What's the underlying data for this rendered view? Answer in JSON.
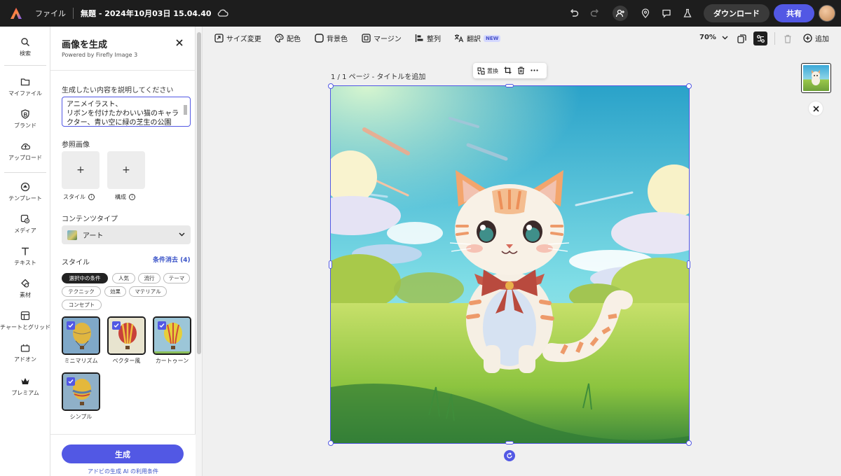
{
  "topbar": {
    "menu_file": "ファイル",
    "doc_title": "無題 - 2024年10月03日 15.04.40",
    "download_label": "ダウンロード",
    "share_label": "共有"
  },
  "rail": {
    "items": [
      {
        "label": "検索",
        "icon": "search-icon"
      },
      {
        "label": "マイファイル",
        "icon": "folder-icon"
      },
      {
        "label": "ブランド",
        "icon": "brand-icon"
      },
      {
        "label": "アップロード",
        "icon": "upload-icon"
      },
      {
        "label": "テンプレート",
        "icon": "template-icon"
      },
      {
        "label": "メディア",
        "icon": "media-icon"
      },
      {
        "label": "テキスト",
        "icon": "text-icon"
      },
      {
        "label": "素材",
        "icon": "shapes-icon"
      },
      {
        "label": "チャートとグリッド",
        "icon": "grid-icon"
      },
      {
        "label": "アドオン",
        "icon": "addon-icon"
      },
      {
        "label": "プレミアム",
        "icon": "crown-icon"
      }
    ]
  },
  "panel": {
    "title": "画像を生成",
    "subtitle": "Powered by Firefly Image 3",
    "prompt_label": "生成したい内容を説明してください",
    "prompt_value": "アニメイラスト、\nリボンを付けたかわいい猫のキャラクター、青い空に緑の芝生の公園",
    "reference_label": "参照画像",
    "ref_style_label": "スタイル",
    "ref_composition_label": "構成",
    "content_type_label": "コンテンツタイプ",
    "content_type_value": "アート",
    "style_label": "スタイル",
    "clear_label": "条件消去 (4)",
    "chips": [
      "選択中の条件",
      "人気",
      "流行",
      "テーマ",
      "テクニック",
      "効果",
      "マテリアル",
      "コンセプト"
    ],
    "style_cards": [
      "ミニマリズム",
      "ベクター風",
      "カートゥーン",
      "シンプル"
    ],
    "generate_label": "生成",
    "terms_label": "アドビの生成 AI の利用条件"
  },
  "toolbar": {
    "resize": "サイズ変更",
    "color": "配色",
    "background": "背景色",
    "margin": "マージン",
    "align": "整列",
    "translate": "翻訳",
    "new_badge": "NEW",
    "zoom": "70%",
    "add": "追加"
  },
  "canvas": {
    "page_label": "1 / 1 ページ - タイトルを追加",
    "replace_label": "置換"
  },
  "colors": {
    "accent": "#5258e4",
    "topbar_bg": "#1d1d1d"
  }
}
